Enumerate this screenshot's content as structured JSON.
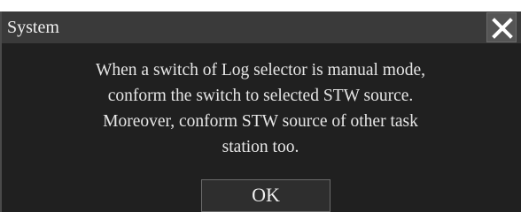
{
  "dialog": {
    "title": "System",
    "close_icon": "close-icon",
    "message_lines": [
      "When a switch of Log selector is manual mode,",
      "conform the switch to selected STW source.",
      "Moreover, conform STW source of other task",
      "station too."
    ],
    "ok_label": "OK"
  },
  "colors": {
    "dialog_background": "#202020",
    "titlebar_background": "#3a3a3a",
    "text": "#e6e6e6"
  }
}
